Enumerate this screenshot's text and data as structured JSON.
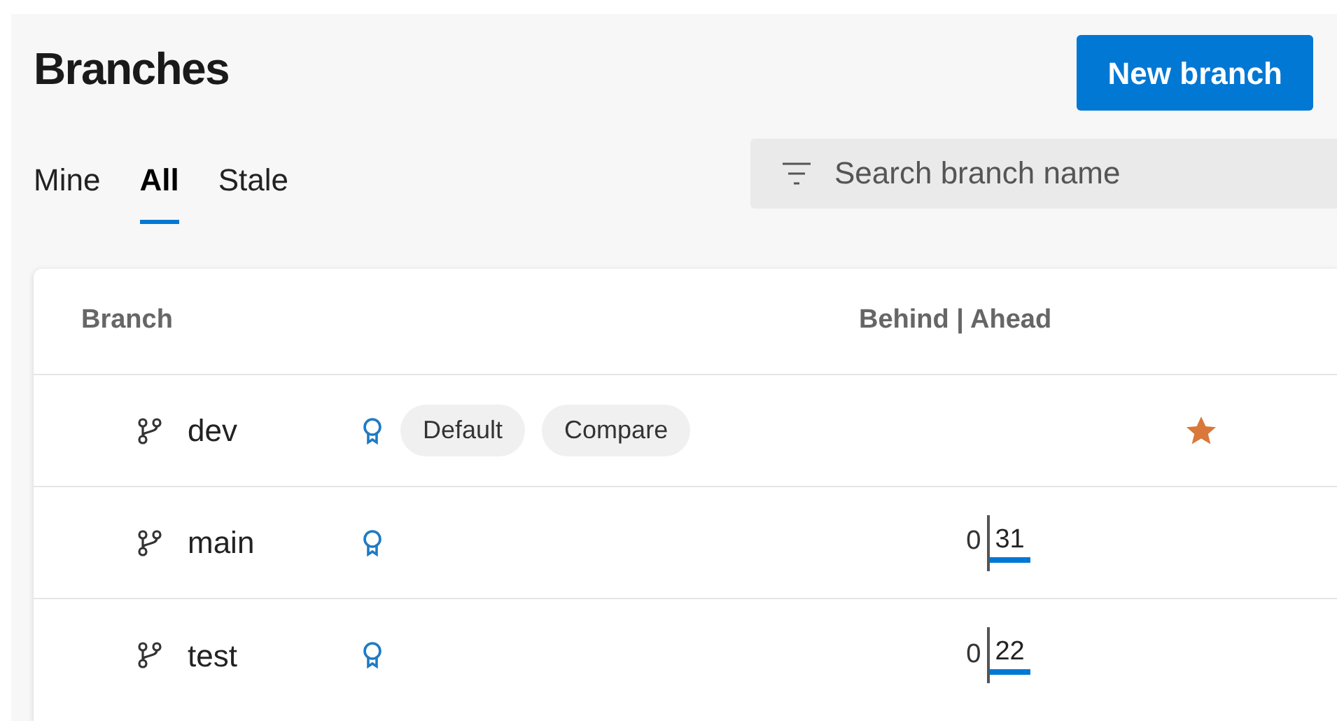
{
  "header": {
    "title": "Branches",
    "new_button": "New branch"
  },
  "tabs": [
    {
      "label": "Mine",
      "selected": false
    },
    {
      "label": "All",
      "selected": true
    },
    {
      "label": "Stale",
      "selected": false
    }
  ],
  "search": {
    "placeholder": "Search branch name"
  },
  "table": {
    "columns": [
      "Branch",
      "Behind | Ahead"
    ],
    "rows": [
      {
        "name": "dev",
        "tags": [
          "Default",
          "Compare"
        ],
        "favorite": true
      },
      {
        "name": "main",
        "tags": [],
        "favorite": false,
        "behind": "0",
        "ahead": "31"
      },
      {
        "name": "test",
        "tags": [],
        "favorite": false,
        "behind": "0",
        "ahead": "22"
      }
    ]
  }
}
